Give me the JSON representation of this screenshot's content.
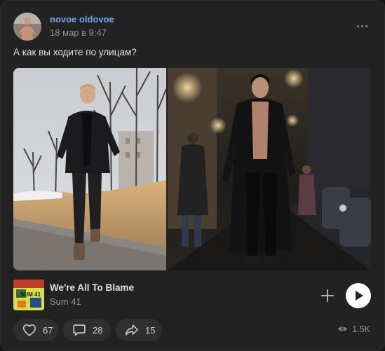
{
  "post": {
    "author_name": "novoe oldovoe",
    "time": "18 мар в 9:47",
    "text": "А как вы ходите по улицам?"
  },
  "photos": [
    {
      "alt": "man-in-black-leather-jacket-walking-in-snow",
      "icon": "photo"
    },
    {
      "alt": "man-in-long-black-leather-coat-night-street",
      "icon": "photo"
    }
  ],
  "music": {
    "title": "We're All To Blame",
    "artist": "Sum 41",
    "cover_text": "SUM 41"
  },
  "actions": {
    "likes": "67",
    "comments": "28",
    "shares": "15",
    "views": "1.5K"
  },
  "colors": {
    "accent": "#71aaeb",
    "card_bg": "#222222",
    "pill_bg": "#2f2f2f",
    "muted_text": "#939393"
  },
  "icons": [
    "more-icon",
    "plus-icon",
    "play-icon",
    "heart-icon",
    "comment-icon",
    "share-icon",
    "eye-icon"
  ]
}
